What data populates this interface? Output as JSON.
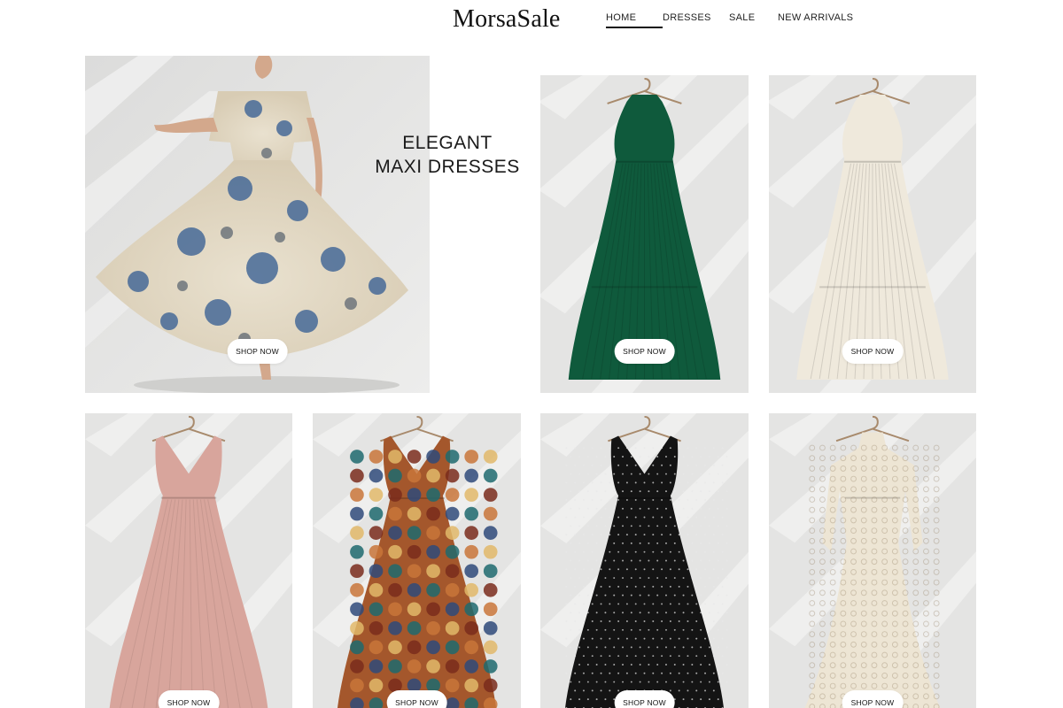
{
  "header": {
    "brand": "MorsaSale",
    "nav": [
      {
        "label": "HOME",
        "active": true
      },
      {
        "label": "DRESSES",
        "active": false
      },
      {
        "label": "SALE",
        "active": false
      },
      {
        "label": "NEW ARRIVALS",
        "active": false
      }
    ]
  },
  "hero": {
    "title_line1": "ELEGANT",
    "title_line2": "MAXI DRESSES",
    "shop_label": "SHOP NOW"
  },
  "products": [
    {
      "dress": "green pleated halter maxi dress",
      "color": "#0f5a3c",
      "shop_label": "SHOP NOW"
    },
    {
      "dress": "ivory pleated halter maxi dress",
      "color": "#efe9dc",
      "shop_label": "SHOP NOW"
    },
    {
      "dress": "blush pink v-neck maxi dress",
      "color": "#d8a59c",
      "shop_label": "SHOP NOW"
    },
    {
      "dress": "paisley print maxi dress",
      "color": "#a4572c",
      "shop_label": "SHOP NOW"
    },
    {
      "dress": "black polka dot maxi dress",
      "color": "#141414",
      "shop_label": "SHOP NOW"
    },
    {
      "dress": "ivory lace bell-sleeve gown",
      "color": "#ede5d4",
      "shop_label": "SHOP NOW"
    }
  ],
  "colors": {
    "background": "#ffffff",
    "text": "#111111",
    "card_background": "#e6e6e5"
  }
}
